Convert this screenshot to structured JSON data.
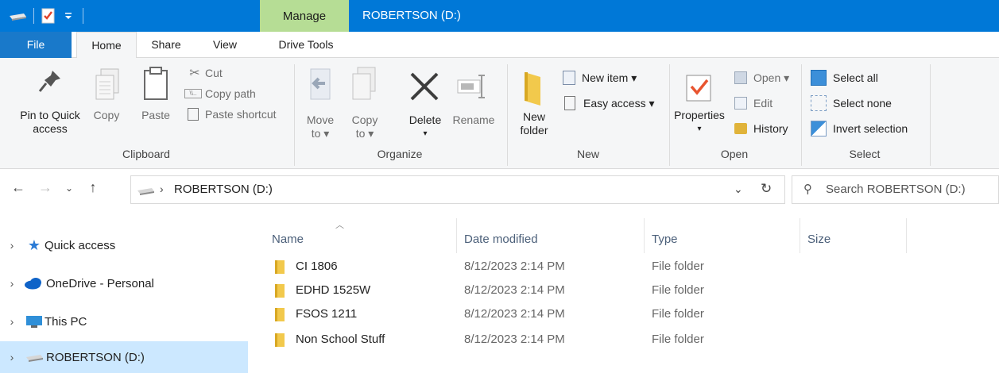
{
  "window": {
    "manage_label": "Manage",
    "title": "ROBERTSON (D:)",
    "qat_icons": [
      "drive-icon",
      "checkmark-properties-icon",
      "customize-dropdown-icon"
    ]
  },
  "tabs": [
    {
      "label": "File"
    },
    {
      "label": "Home"
    },
    {
      "label": "Share"
    },
    {
      "label": "View"
    },
    {
      "label": "Drive Tools"
    }
  ],
  "ribbon": {
    "clipboard": {
      "label": "Clipboard",
      "pin": "Pin to Quick access",
      "pin_line1": "Pin to Quick",
      "pin_line2": "access",
      "copy": "Copy",
      "paste": "Paste",
      "cut": "Cut",
      "copy_path": "Copy path",
      "paste_shortcut": "Paste shortcut"
    },
    "organize": {
      "label": "Organize",
      "move_to_line1": "Move",
      "move_to_line2": "to ▾",
      "copy_to_line1": "Copy",
      "copy_to_line2": "to ▾",
      "delete": "Delete",
      "delete_caret": "▾",
      "rename": "Rename"
    },
    "new": {
      "label": "New",
      "new_folder_line1": "New",
      "new_folder_line2": "folder",
      "new_item": "New item ▾",
      "easy_access": "Easy access ▾"
    },
    "open": {
      "label": "Open",
      "properties": "Properties",
      "properties_caret": "▾",
      "open": "Open ▾",
      "edit": "Edit",
      "history": "History"
    },
    "select": {
      "label": "Select",
      "select_all": "Select all",
      "select_none": "Select none",
      "invert_selection": "Invert selection"
    }
  },
  "address": {
    "path": "ROBERTSON (D:)",
    "search_placeholder": "Search ROBERTSON (D:)"
  },
  "nav": [
    {
      "label": "Quick access",
      "icon": "star-icon"
    },
    {
      "label": "OneDrive - Personal",
      "icon": "cloud-icon"
    },
    {
      "label": "This PC",
      "icon": "pc-icon"
    },
    {
      "label": "ROBERTSON (D:)",
      "icon": "drive-icon",
      "selected": true
    }
  ],
  "columns": [
    "Name",
    "Date modified",
    "Type",
    "Size"
  ],
  "files": [
    {
      "name": "CI 1806",
      "date": "8/12/2023 2:14 PM",
      "type": "File folder",
      "size": ""
    },
    {
      "name": "EDHD 1525W",
      "date": "8/12/2023 2:14 PM",
      "type": "File folder",
      "size": ""
    },
    {
      "name": "FSOS 1211",
      "date": "8/12/2023 2:14 PM",
      "type": "File folder",
      "size": ""
    },
    {
      "name": "Non School Stuff",
      "date": "8/12/2023 2:14 PM",
      "type": "File folder",
      "size": ""
    }
  ],
  "colors": {
    "titlebar": "#0078d7",
    "manage_tab": "#b6dd95",
    "file_tab": "#1979ca",
    "selection": "#cce8ff",
    "folder": "#f2c94c"
  }
}
